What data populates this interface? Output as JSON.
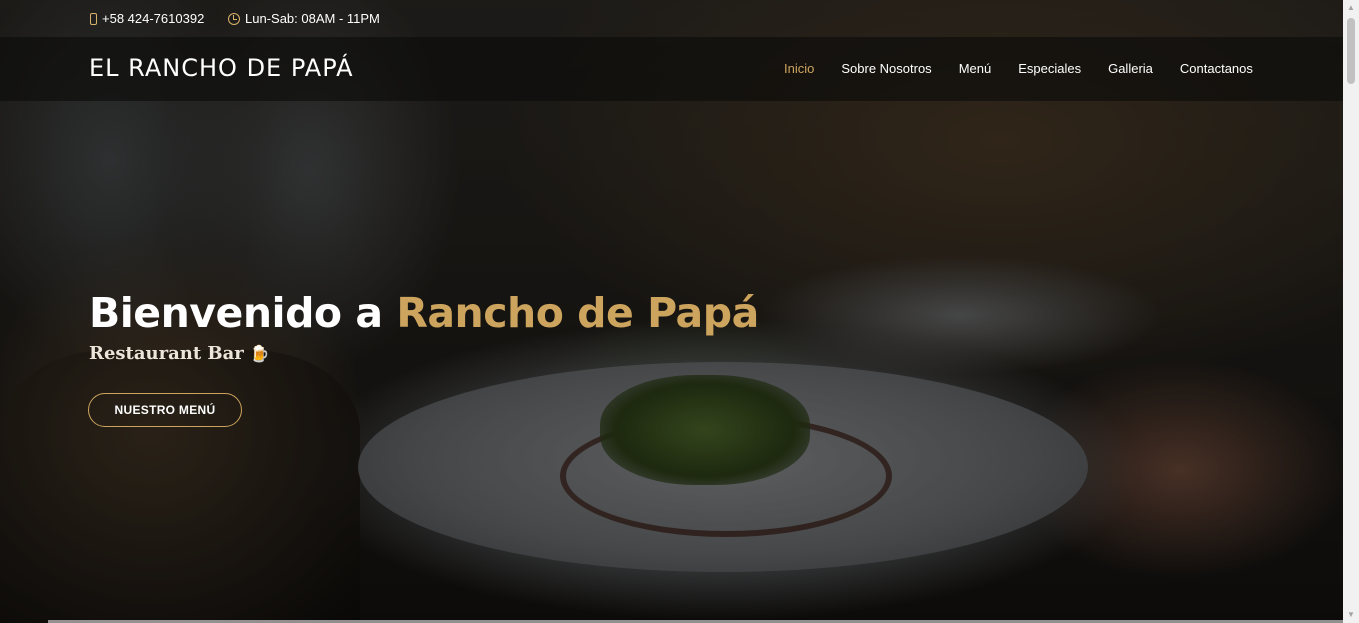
{
  "topbar": {
    "phone": "+58 424-7610392",
    "hours": "Lun-Sab: 08AM - 11PM",
    "phone_icon": "mobile-phone-icon",
    "hours_icon": "clock-icon"
  },
  "header": {
    "logo": "EL RANCHO DE PAPÁ",
    "nav": [
      {
        "label": "Inicio",
        "active": true
      },
      {
        "label": "Sobre Nosotros",
        "active": false
      },
      {
        "label": "Menú",
        "active": false
      },
      {
        "label": "Especiales",
        "active": false
      },
      {
        "label": "Galleria",
        "active": false
      },
      {
        "label": "Contactanos",
        "active": false
      }
    ]
  },
  "hero": {
    "headline_prefix": "Bienvenido a ",
    "headline_accent": "Rancho de Papá",
    "subtitle": "Restaurant Bar",
    "subtitle_emoji": "🍺",
    "button_label": "NUESTRO MENÚ"
  },
  "colors": {
    "accent": "#cda45e",
    "header_bg": "#0c0b09"
  }
}
